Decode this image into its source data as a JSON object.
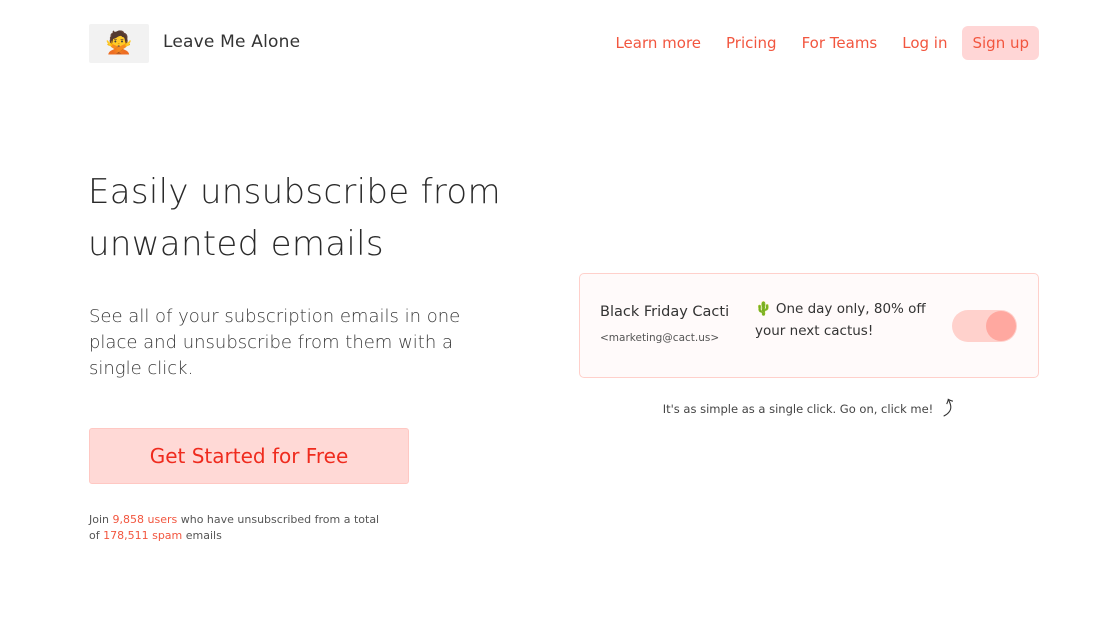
{
  "header": {
    "logo_icon": "woman-gesturing-no-emoji",
    "logo_glyph": "🙅",
    "brand": "Leave Me Alone",
    "nav": [
      {
        "label": "Learn more"
      },
      {
        "label": "Pricing"
      },
      {
        "label": "For Teams"
      },
      {
        "label": "Log in"
      },
      {
        "label": "Sign up"
      }
    ]
  },
  "hero": {
    "title": "Easily unsubscribe from unwanted emails",
    "subtitle": "See all of your subscription emails in one place and unsubscribe from them with a single click.",
    "cta_label": "Get Started for Free"
  },
  "stats": {
    "prefix": "Join",
    "users": "9,858 users",
    "middle": "who have unsubscribed from a total of",
    "spam": "178,511 spam",
    "suffix": "emails"
  },
  "demo_card": {
    "sender": "Black Friday Cacti",
    "email": "<marketing@cact.us>",
    "subject_icon": "cactus-emoji",
    "subject_glyph": "🌵",
    "subject": "One day only, 80% off your next cactus!",
    "toggle_on": true
  },
  "hint": {
    "text": "It's as simple as a single click. Go on, click me!",
    "icon": "curved-arrow-icon",
    "glyph": "⤴"
  },
  "colors": {
    "accent": "#f2563f",
    "cta_bg": "#ffd9d6",
    "cta_text": "#ef2b1e"
  }
}
